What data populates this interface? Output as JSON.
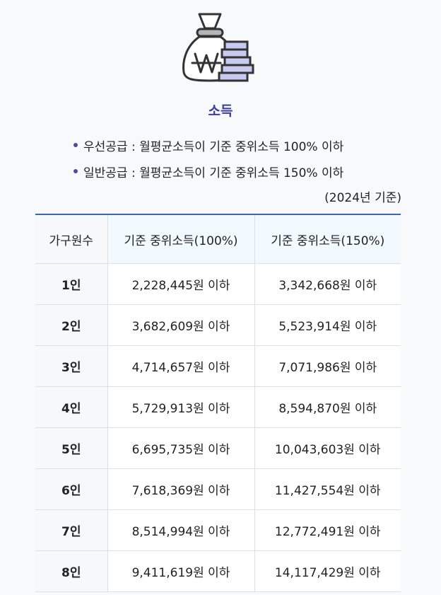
{
  "title": "소득",
  "bullets": [
    "우선공급 : 월평균소득이 기준 중위소득 100% 이하",
    "일반공급 : 월평균소득이 기준 중위소득 150% 이하"
  ],
  "base_year": "(2024년 기준)",
  "icon": "money-bag-won-icon",
  "colors": {
    "title": "#3b3f99",
    "table_top_border": "#3a66b8",
    "coin": "#c9caf0"
  },
  "table": {
    "headers": [
      "가구원수",
      "기준 중위소득(100%)",
      "기준 중위소득(150%)"
    ],
    "rows": [
      [
        "1인",
        "2,228,445원 이하",
        "3,342,668원 이하"
      ],
      [
        "2인",
        "3,682,609원 이하",
        "5,523,914원 이하"
      ],
      [
        "3인",
        "4,714,657원 이하",
        "7,071,986원 이하"
      ],
      [
        "4인",
        "5,729,913원 이하",
        "8,594,870원 이하"
      ],
      [
        "5인",
        "6,695,735원 이하",
        "10,043,603원 이하"
      ],
      [
        "6인",
        "7,618,369원 이하",
        "11,427,554원 이하"
      ],
      [
        "7인",
        "8,514,994원 이하",
        "12,772,491원 이하"
      ],
      [
        "8인",
        "9,411,619원 이하",
        "14,117,429원 이하"
      ]
    ]
  }
}
